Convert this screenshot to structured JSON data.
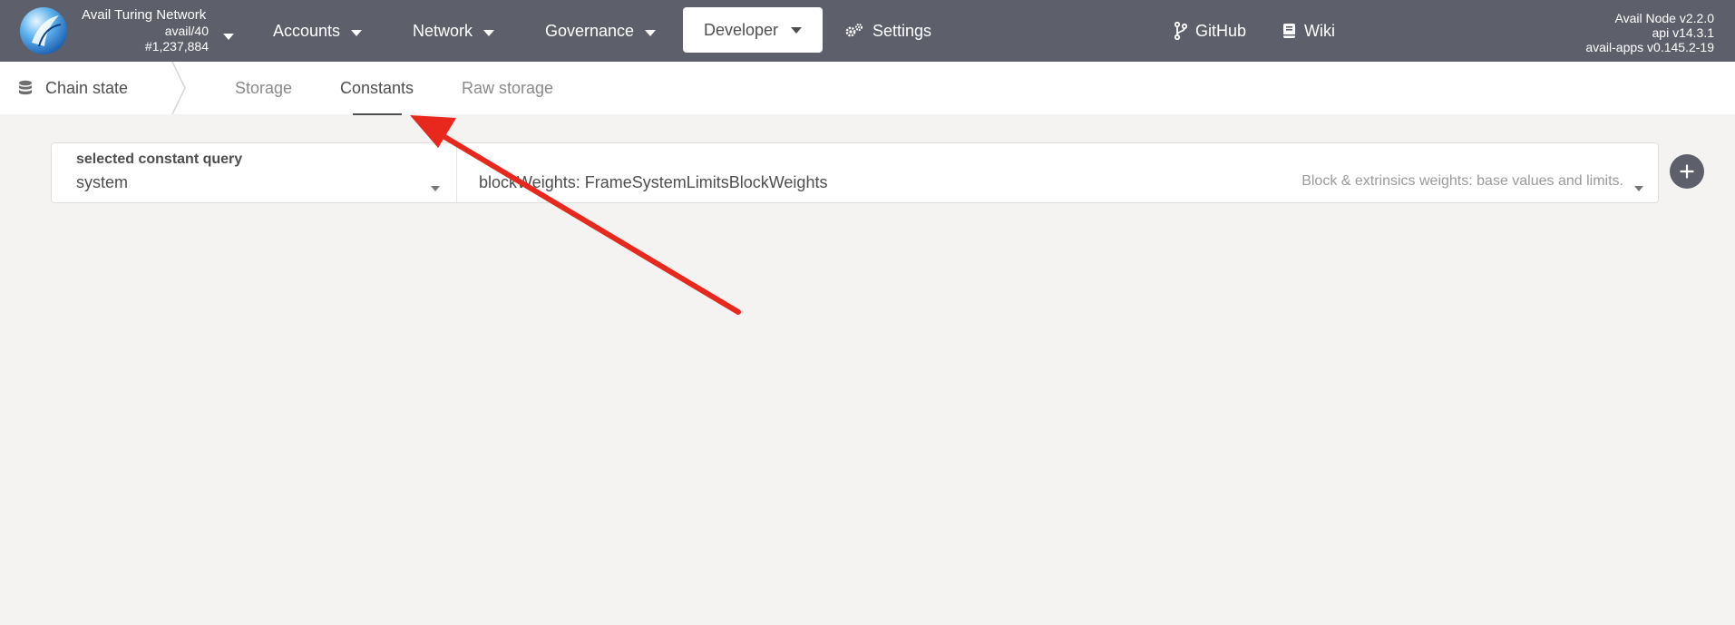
{
  "chain": {
    "name": "Avail Turing Network",
    "runtime": "avail/40",
    "block": "#1,237,884"
  },
  "nav": {
    "accounts": "Accounts",
    "network": "Network",
    "governance": "Governance",
    "developer": "Developer",
    "settings": "Settings",
    "github": "GitHub",
    "wiki": "Wiki"
  },
  "versions": {
    "node": "Avail Node v2.2.0",
    "api": "api v14.3.1",
    "apps": "avail-apps v0.145.2-19"
  },
  "subnav": {
    "section": "Chain state",
    "tabs": [
      "Storage",
      "Constants",
      "Raw storage"
    ],
    "active_tab": "Constants"
  },
  "query": {
    "label": "selected constant query",
    "module": "system",
    "method": "blockWeights: FrameSystemLimitsBlockWeights",
    "description": "Block & extrinsics weights: base values and limits."
  },
  "colors": {
    "topbar": "#5d606a",
    "annotation_arrow": "#e8281c"
  },
  "icons": {
    "logo": "avail-logo",
    "settings": "gears-icon",
    "github": "code-branch-icon",
    "wiki": "book-icon",
    "section": "database-icon",
    "add": "plus-icon"
  }
}
